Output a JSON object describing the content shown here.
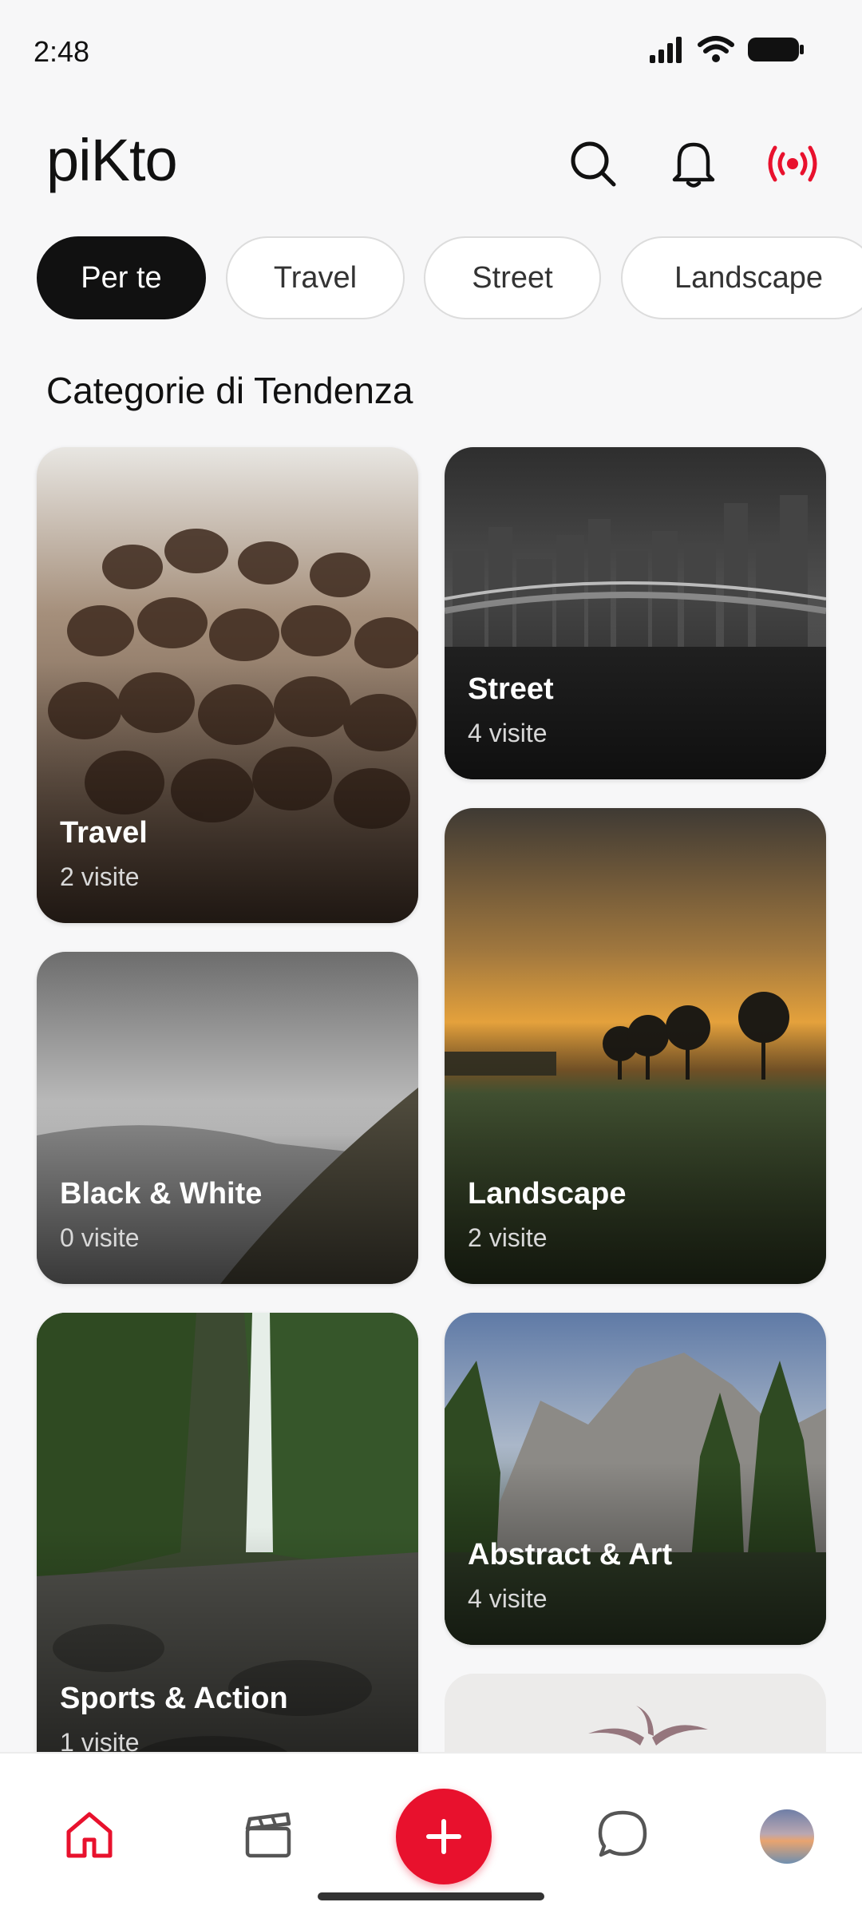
{
  "status_bar": {
    "time": "2:48"
  },
  "header": {
    "logo": "piKto"
  },
  "chips": [
    "Per te",
    "Travel",
    "Street",
    "Landscape"
  ],
  "section_title": "Categorie di Tendenza",
  "cards": [
    {
      "name": "Travel",
      "visits": "2 visite"
    },
    {
      "name": "Street",
      "visits": "4 visite"
    },
    {
      "name": "Black & White",
      "visits": "0 visite"
    },
    {
      "name": "Landscape",
      "visits": "2 visite"
    },
    {
      "name": "Sports & Action",
      "visits": "1 visite"
    },
    {
      "name": "Abstract & Art",
      "visits": "4 visite"
    }
  ],
  "colors": {
    "accent": "#e8112d",
    "active_chip": "#111111"
  },
  "icons": [
    "signal-icon",
    "wifi-icon",
    "battery-icon",
    "search-icon",
    "bell-icon",
    "live-broadcast-icon",
    "home-icon",
    "clapperboard-icon",
    "plus-icon",
    "chat-bubble-icon"
  ]
}
